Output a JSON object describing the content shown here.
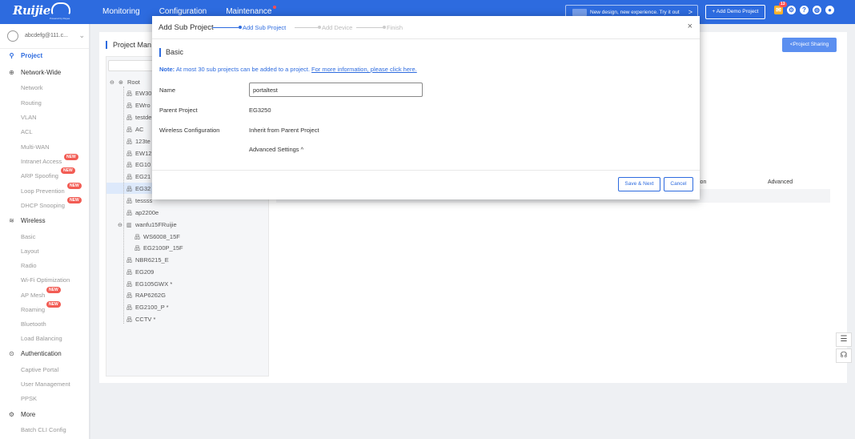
{
  "brand": {
    "logo_text": "Ruijie",
    "logo_sub": "Powered by Reyee"
  },
  "nav": {
    "monitoring": "Monitoring",
    "configuration": "Configuration",
    "maintenance": "Maintenance"
  },
  "banner": {
    "text": "New design, new experience. Try it out",
    "arrow": ">"
  },
  "header": {
    "demo_button": "+ Add Demo Project",
    "notification_count": "13"
  },
  "user": {
    "name": "abcdefg@111.c..."
  },
  "sidebar": {
    "project": "Project",
    "network_wide": "Network-Wide",
    "network_items": [
      "Network",
      "Routing",
      "VLAN",
      "ACL",
      "Multi-WAN",
      "Intranet Access",
      "ARP Spoofing",
      "Loop Prevention",
      "DHCP Snooping"
    ],
    "wireless": "Wireless",
    "wireless_items": [
      "Basic",
      "Layout",
      "Radio",
      "Wi-Fi Optimization",
      "AP Mesh",
      "Roaming",
      "Bluetooth",
      "Load Balancing"
    ],
    "authentication": "Authentication",
    "auth_items": [
      "Captive Portal",
      "User Management",
      "PPSK"
    ],
    "more": "More",
    "more_items": [
      "Batch CLI Config"
    ],
    "new_tag": "NEW"
  },
  "page": {
    "title": "Project Man",
    "share_button": "<Project Sharing",
    "col_option": "ion",
    "col_advanced": "Advanced"
  },
  "tree": [
    "Root",
    "EW30",
    "EWro",
    "testde",
    "AC",
    "123te",
    "EW12",
    "EG10",
    "EG21",
    "EG32",
    "tessss",
    "ap2200e",
    "wanfu15FRuijie",
    "WS6008_15F",
    "EG2100P_15F",
    "NBR6215_E",
    "EG209",
    "EG105GWX *",
    "RAP6262G",
    "EG2100_P *",
    "CCTV *"
  ],
  "modal": {
    "title": "Add Sub Project",
    "steps": [
      "Add Sub Project",
      "Add Device",
      "Finish"
    ],
    "close": "×",
    "section": "Basic",
    "note_label": "Note:",
    "note_text": "At most 30 sub projects can be added to a project.",
    "note_link": "For more information, please click here.",
    "name_label": "Name",
    "name_value": "portaltest",
    "parent_label": "Parent Project",
    "parent_value": "EG3250",
    "wireless_label": "Wireless Configuration",
    "wireless_value": "Inherit from Parent Project",
    "advanced_label": "Advanced Settings ^",
    "save_button": "Save & Next",
    "cancel_button": "Cancel"
  },
  "colors": {
    "accent": "#2d6bdf",
    "new_tag": "#f25c54",
    "notification": "#ffb22b"
  }
}
